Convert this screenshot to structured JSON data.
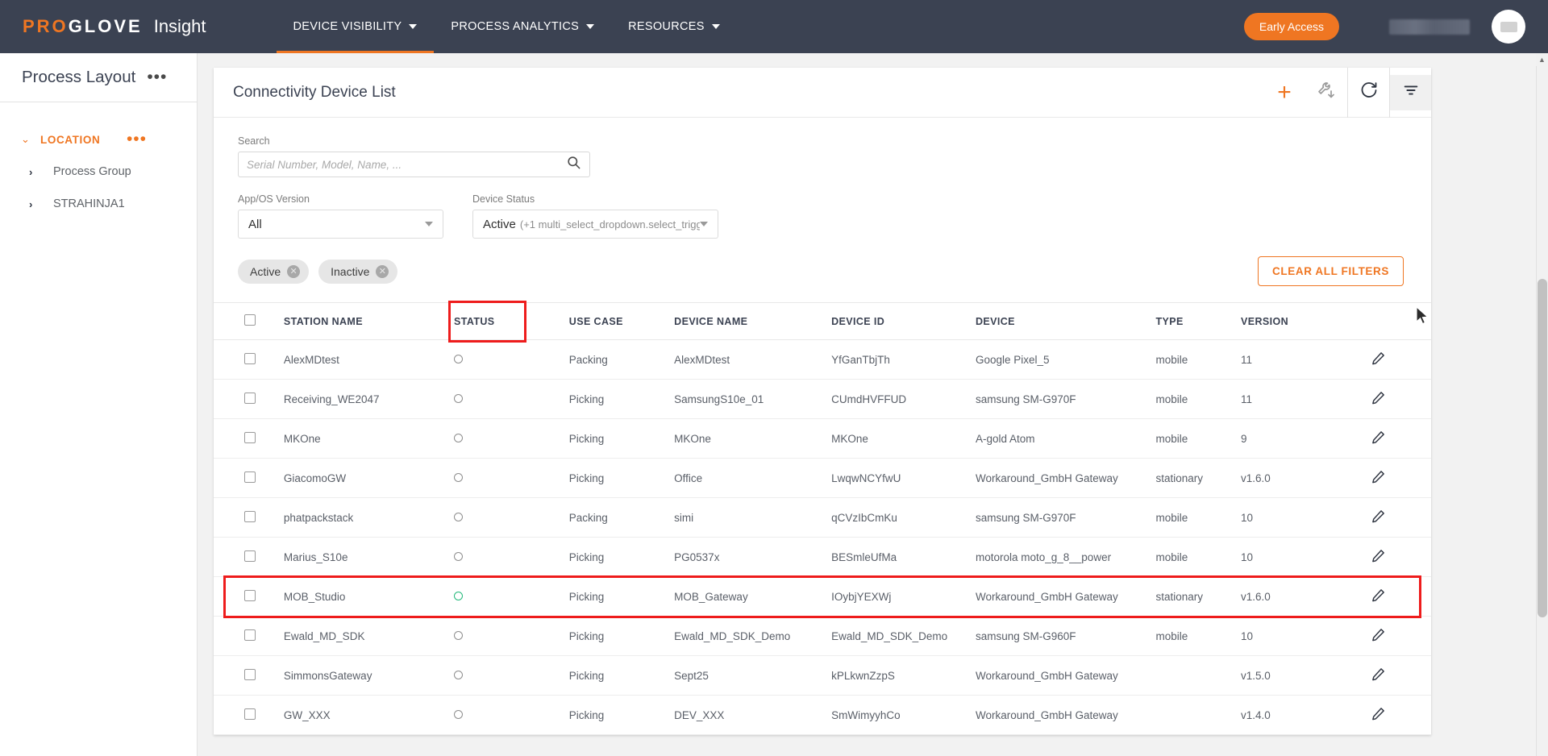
{
  "topnav": {
    "logo_pro": "PRO",
    "logo_glove": "GLOVE",
    "logo_product": "Insight",
    "items": [
      {
        "label": "DEVICE VISIBILITY",
        "icon": "chevron-down-icon",
        "active": true
      },
      {
        "label": "PROCESS ANALYTICS",
        "icon": "chevron-down-icon",
        "active": false
      },
      {
        "label": "RESOURCES",
        "icon": "chevron-down-icon",
        "active": false
      }
    ],
    "early_access_label": "Early Access",
    "accent_color": "#ef7622",
    "bar_color": "#3b4252"
  },
  "sidebar": {
    "title": "Process Layout",
    "title_menu": "•••",
    "section": {
      "label": "LOCATION",
      "menu": "•••",
      "chevron": "⌄"
    },
    "items": [
      {
        "label": "Process Group",
        "chevron": "›"
      },
      {
        "label": "STRAHINJA1",
        "chevron": "›"
      }
    ]
  },
  "card": {
    "title": "Connectivity Device List",
    "actions": [
      {
        "name": "add-device-button",
        "glyph": "+"
      },
      {
        "name": "configure-tool-button",
        "glyph": "wrench-download-icon"
      },
      {
        "name": "refresh-button",
        "glyph": "refresh-icon"
      },
      {
        "name": "filter-button",
        "glyph": "filter-icon"
      }
    ]
  },
  "filters": {
    "search_label": "Search",
    "search_value": "",
    "search_placeholder": "Serial Number, Model, Name, ...",
    "search_icon": "search-icon",
    "app_os_label": "App/OS Version",
    "app_os_value": "All",
    "device_status_label": "Device Status",
    "device_status_value": "Active",
    "device_status_extra": "(+1 multi_select_dropdown.select_trigge…",
    "chips": [
      {
        "label": "Active",
        "remove": "✕"
      },
      {
        "label": "Inactive",
        "remove": "✕"
      }
    ],
    "clear_label": "CLEAR ALL FILTERS"
  },
  "table": {
    "columns": [
      "STATION NAME",
      "STATUS",
      "USE CASE",
      "DEVICE NAME",
      "DEVICE ID",
      "DEVICE",
      "TYPE",
      "VERSION"
    ],
    "rows": [
      {
        "station": "AlexMDtest",
        "status": "inactive",
        "use_case": "Packing",
        "device_name": "AlexMDtest",
        "device_id": "YfGanTbjTh",
        "device": "Google Pixel_5",
        "type": "mobile",
        "version": "11",
        "highlighted": false
      },
      {
        "station": "Receiving_WE2047",
        "status": "inactive",
        "use_case": "Picking",
        "device_name": "SamsungS10e_01",
        "device_id": "CUmdHVFFUD",
        "device": "samsung SM-G970F",
        "type": "mobile",
        "version": "11",
        "highlighted": false
      },
      {
        "station": "MKOne",
        "status": "inactive",
        "use_case": "Picking",
        "device_name": "MKOne",
        "device_id": "MKOne",
        "device": "A-gold Atom",
        "type": "mobile",
        "version": "9",
        "highlighted": false
      },
      {
        "station": "GiacomoGW",
        "status": "inactive",
        "use_case": "Picking",
        "device_name": "Office",
        "device_id": "LwqwNCYfwU",
        "device": "Workaround_GmbH Gateway",
        "type": "stationary",
        "version": "v1.6.0",
        "highlighted": false
      },
      {
        "station": "phatpackstack",
        "status": "inactive",
        "use_case": "Packing",
        "device_name": "simi",
        "device_id": "qCVzIbCmKu",
        "device": "samsung SM-G970F",
        "type": "mobile",
        "version": "10",
        "highlighted": false
      },
      {
        "station": "Marius_S10e",
        "status": "inactive",
        "use_case": "Picking",
        "device_name": "PG0537x",
        "device_id": "BESmleUfMa",
        "device": "motorola moto_g_8__power",
        "type": "mobile",
        "version": "10",
        "highlighted": false
      },
      {
        "station": "MOB_Studio",
        "status": "active",
        "use_case": "Picking",
        "device_name": "MOB_Gateway",
        "device_id": "IOybjYEXWj",
        "device": "Workaround_GmbH Gateway",
        "type": "stationary",
        "version": "v1.6.0",
        "highlighted": true
      },
      {
        "station": "Ewald_MD_SDK",
        "status": "inactive",
        "use_case": "Picking",
        "device_name": "Ewald_MD_SDK_Demo",
        "device_id": "Ewald_MD_SDK_Demo",
        "device": "samsung SM-G960F",
        "type": "mobile",
        "version": "10",
        "highlighted": false
      },
      {
        "station": "SimmonsGateway",
        "status": "inactive",
        "use_case": "Picking",
        "device_name": "Sept25",
        "device_id": "kPLkwnZzpS",
        "device": "Workaround_GmbH Gateway",
        "type": "",
        "version": "v1.5.0",
        "highlighted": false
      },
      {
        "station": "GW_XXX",
        "status": "inactive",
        "use_case": "Picking",
        "device_name": "DEV_XXX",
        "device_id": "SmWimyyhCo",
        "device": "Workaround_GmbH Gateway",
        "type": "",
        "version": "v1.4.0",
        "highlighted": false
      }
    ],
    "row_edit_icon": "pencil-icon",
    "select_all_icon": "checkbox-icon",
    "status_active_color": "#23b87a",
    "status_inactive_color": "#8d8d8d"
  },
  "annotations": {
    "color": "#ee1c1c",
    "boxes": [
      "status-column-header",
      "mob-studio-row"
    ]
  }
}
